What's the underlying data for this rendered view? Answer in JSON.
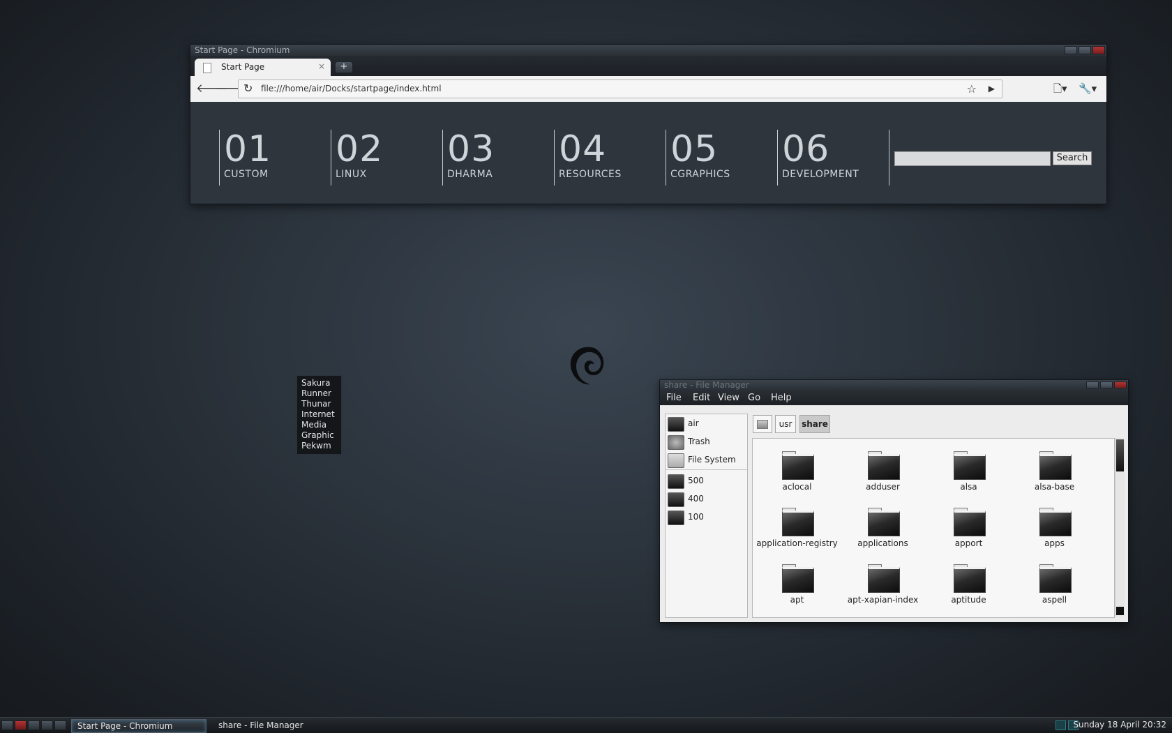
{
  "chromium": {
    "window_title": "Start Page - Chromium",
    "tab_title": "Start Page",
    "tab_close": "×",
    "new_tab": "+",
    "url": "file:///home/air/Docks/startpage/index.html",
    "categories": [
      {
        "num": "01",
        "label": "CUSTOM"
      },
      {
        "num": "02",
        "label": "LINUX"
      },
      {
        "num": "03",
        "label": "DHARMA"
      },
      {
        "num": "04",
        "label": "RESOURCES"
      },
      {
        "num": "05",
        "label": "CGRAPHICS"
      },
      {
        "num": "06",
        "label": "DEVELOPMENT"
      }
    ],
    "search_value": "",
    "search_button": "Search"
  },
  "root_menu": {
    "items": [
      "Sakura",
      "Runner",
      "Thunar",
      "Internet",
      "Media",
      "Graphic",
      "Pekwm"
    ]
  },
  "file_manager": {
    "window_title": "share - File Manager",
    "menu": [
      "File",
      "Edit",
      "View",
      "Go",
      "Help"
    ],
    "side_places": [
      "air",
      "Trash",
      "File System"
    ],
    "side_bookmarks": [
      "500",
      "400",
      "100"
    ],
    "path": [
      "usr",
      "share"
    ],
    "folders": [
      "aclocal",
      "adduser",
      "alsa",
      "alsa-base",
      "application-registry",
      "applications",
      "apport",
      "apps",
      "apt",
      "apt-xapian-index",
      "aptitude",
      "aspell"
    ]
  },
  "panel": {
    "tasks": [
      "Start Page - Chromium",
      "share - File Manager"
    ],
    "clock": "Sunday 18 April 20:32"
  },
  "colors": {
    "desktop": "#2b333c",
    "panel": "#1a1e22",
    "close_button": "#b33434",
    "tray_accent": "#2e7a86"
  }
}
